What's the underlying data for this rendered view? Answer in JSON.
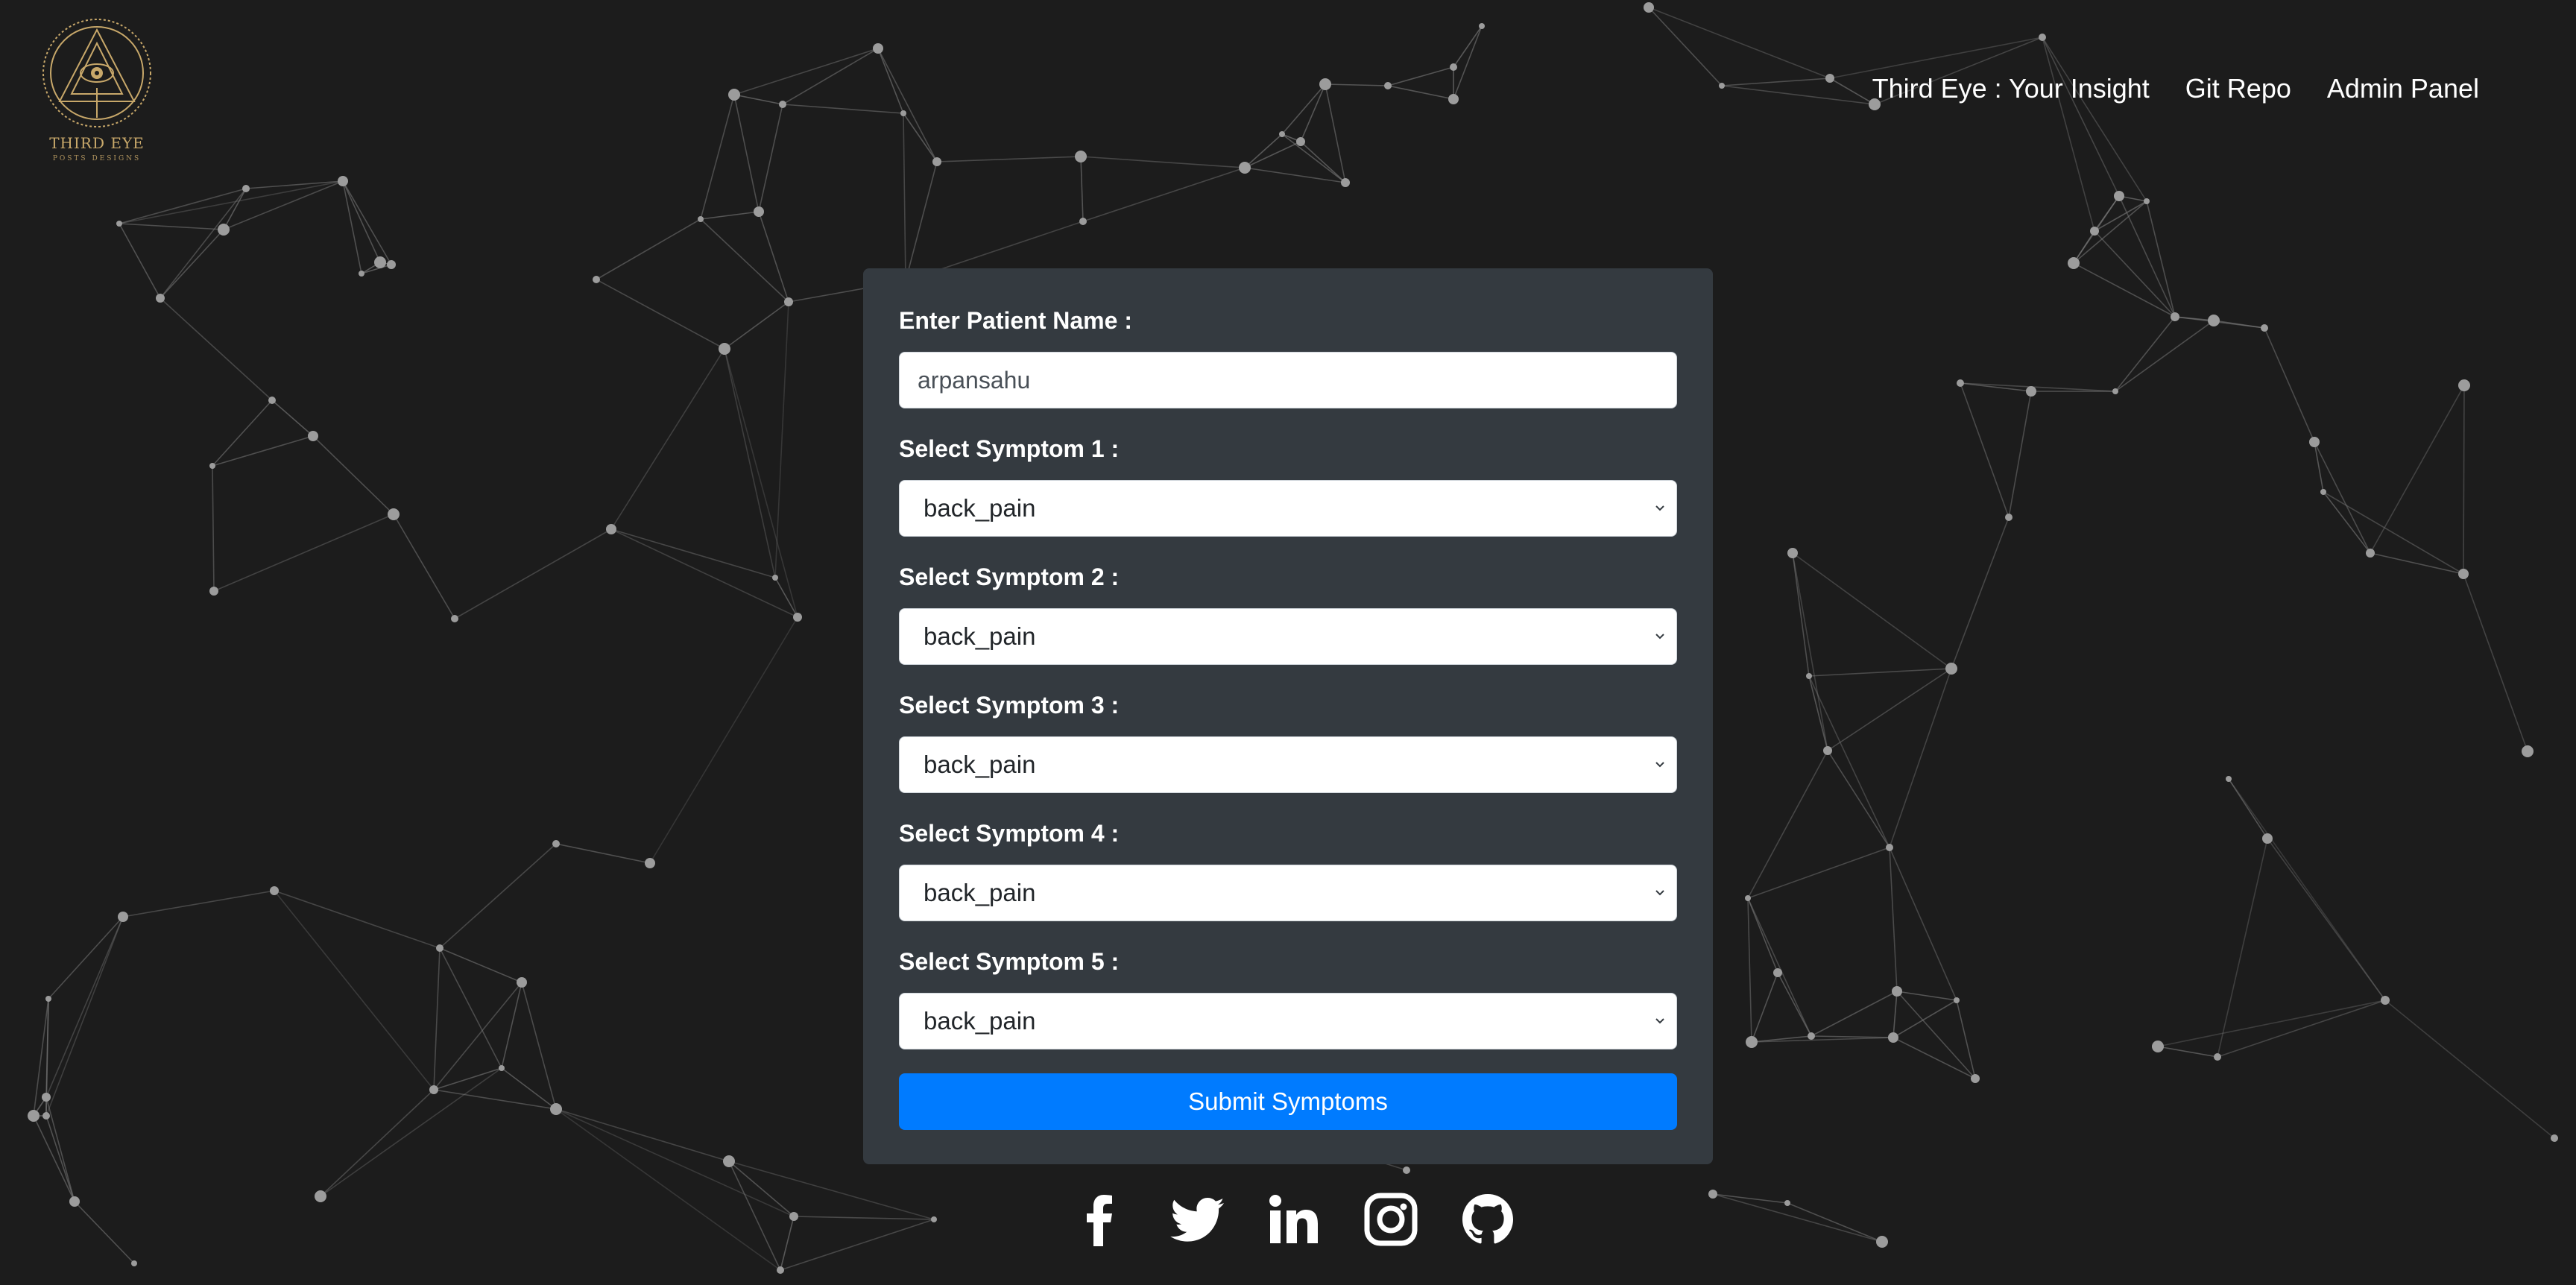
{
  "logo": {
    "title": "THIRD EYE",
    "subtitle": "POSTS DESIGNS",
    "gold": "#c8a86a"
  },
  "nav": {
    "items": [
      {
        "label": "Third Eye : Your Insight"
      },
      {
        "label": "Git Repo"
      },
      {
        "label": "Admin Panel"
      }
    ]
  },
  "form": {
    "patient_label": "Enter Patient Name :",
    "patient_value": "arpansahu",
    "symptoms": [
      {
        "label": "Select Symptom 1 :",
        "value": "back_pain"
      },
      {
        "label": "Select Symptom 2 :",
        "value": "back_pain"
      },
      {
        "label": "Select Symptom 3 :",
        "value": "back_pain"
      },
      {
        "label": "Select Symptom 4 :",
        "value": "back_pain"
      },
      {
        "label": "Select Symptom 5 :",
        "value": "back_pain"
      }
    ],
    "submit_label": "Submit Symptoms"
  },
  "social": {
    "icons": [
      "facebook-icon",
      "twitter-icon",
      "linkedin-icon",
      "instagram-icon",
      "github-icon"
    ]
  },
  "colors": {
    "background": "#1c1c1c",
    "card": "#343a40",
    "accent": "#007bff",
    "network": "#9a9a9a"
  }
}
